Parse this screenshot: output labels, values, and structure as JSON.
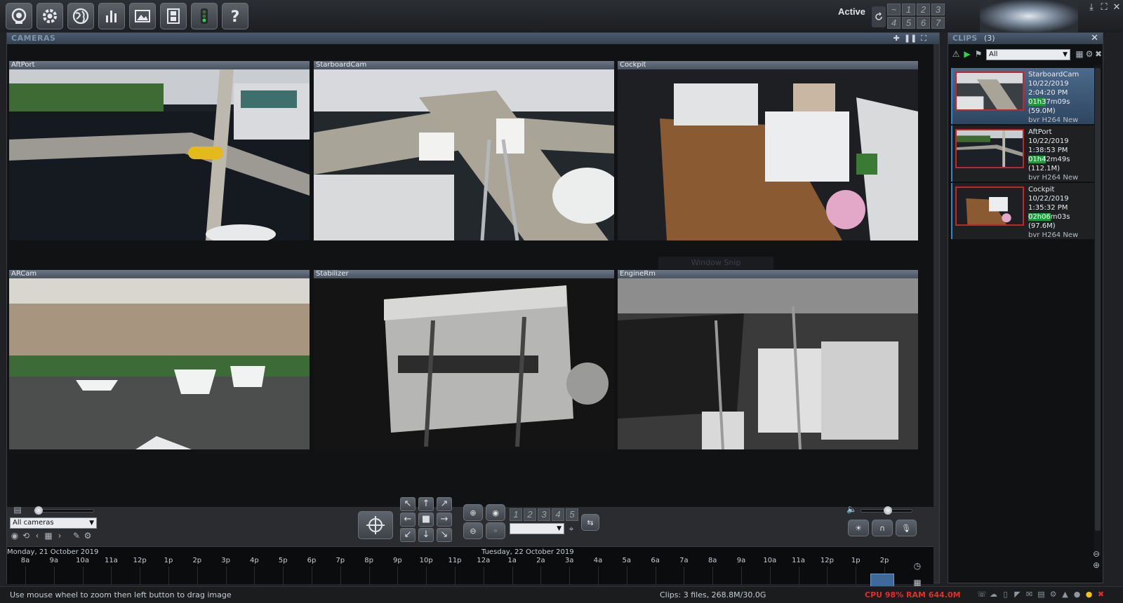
{
  "toolbar": {
    "active_label": "Active",
    "groups": [
      "~",
      "1",
      "2",
      "3",
      "4",
      "5",
      "6",
      "7"
    ]
  },
  "cameras_panel": {
    "title": "CAMERAS",
    "window_snip": "Window Snip",
    "cameras": [
      {
        "name": "AftPort"
      },
      {
        "name": "StarboardCam"
      },
      {
        "name": "Cockpit"
      },
      {
        "name": "ARCam"
      },
      {
        "name": "Stabilizer"
      },
      {
        "name": "EngineRm"
      }
    ]
  },
  "controls": {
    "camera_select": "All cameras",
    "presets": [
      "1",
      "2",
      "3",
      "4",
      "5"
    ]
  },
  "timeline": {
    "date_left": "Monday, 21 October 2019",
    "date_right": "Tuesday, 22 October 2019",
    "ticks": [
      "8a",
      "9a",
      "10a",
      "11a",
      "12p",
      "1p",
      "2p",
      "3p",
      "4p",
      "5p",
      "6p",
      "7p",
      "8p",
      "9p",
      "10p",
      "11p",
      "12a",
      "1a",
      "2a",
      "3a",
      "4a",
      "5a",
      "6a",
      "7a",
      "8a",
      "9a",
      "10a",
      "11a",
      "12p",
      "1p",
      "2p"
    ]
  },
  "clips_panel": {
    "title": "CLIPS",
    "count": "(3)",
    "filter": "All",
    "clips": [
      {
        "camera": "StarboardCam",
        "date": "10/22/2019",
        "time": "2:04:20 PM",
        "dur_hl": "01h3",
        "dur_rest": "7m09s (59.0M)",
        "meta": "bvr H264 New"
      },
      {
        "camera": "AftPort",
        "date": "10/22/2019",
        "time": "1:38:53 PM",
        "dur_hl": "01h4",
        "dur_rest": "2m49s (112.1M)",
        "meta": "bvr H264 New"
      },
      {
        "camera": "Cockpit",
        "date": "10/22/2019",
        "time": "1:35:32 PM",
        "dur_hl": "02h06",
        "dur_rest": "m03s (97.6M)",
        "meta": "bvr H264 New"
      }
    ]
  },
  "status": {
    "hint": "Use mouse wheel to zoom then left button to drag image",
    "clips_info": "Clips: 3 files, 268.8M/30.0G",
    "cpu": "CPU 98% RAM 644.0M"
  }
}
